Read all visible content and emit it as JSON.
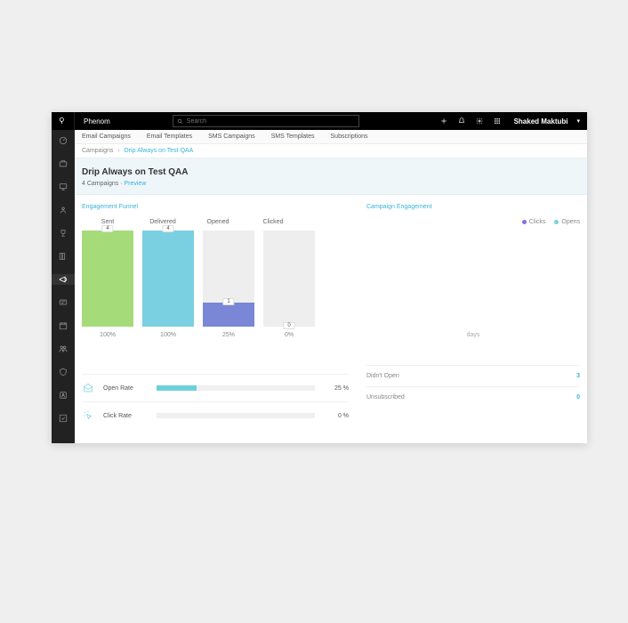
{
  "brand": "Phenom",
  "search": {
    "placeholder": "Search"
  },
  "user": {
    "name": "Shaked Maktubi"
  },
  "tabs": [
    "Email Campaigns",
    "Email Templates",
    "SMS Campaigns",
    "SMS Templates",
    "Subscriptions"
  ],
  "breadcrumb": {
    "parent": "Campaigns",
    "current": "Drip Always on Test QAA"
  },
  "hero": {
    "title": "Drip Always on Test QAA",
    "count": "4 Campaigns",
    "previewLabel": "Preview"
  },
  "sections": {
    "funnel": "Engagement Funnel",
    "engagement": "Campaign Engagement"
  },
  "chart_data": {
    "type": "bar",
    "title": "Engagement Funnel",
    "categories": [
      "Sent",
      "Delivered",
      "Opened",
      "Clicked"
    ],
    "values": [
      4,
      4,
      1,
      0
    ],
    "percentages": [
      "100%",
      "100%",
      "25%",
      "0%"
    ],
    "colors": [
      "#a6db7a",
      "#7ad0e0",
      "#7a86d6",
      "#e0e0e0"
    ],
    "ylim": [
      0,
      4
    ]
  },
  "rates": {
    "open": {
      "label": "Open Rate",
      "value": "25 %",
      "pct": 25
    },
    "click": {
      "label": "Click Rate",
      "value": "0 %",
      "pct": 0
    }
  },
  "legend": {
    "clicks": "Clicks",
    "opens": "Opens",
    "clicksColor": "#8a6de0",
    "opensColor": "#7ad0e0"
  },
  "engagementAxis": "days",
  "stats": {
    "didntOpen": {
      "label": "Didn't Open",
      "value": "3"
    },
    "unsubscribed": {
      "label": "Unsubscribed",
      "value": "0"
    }
  }
}
